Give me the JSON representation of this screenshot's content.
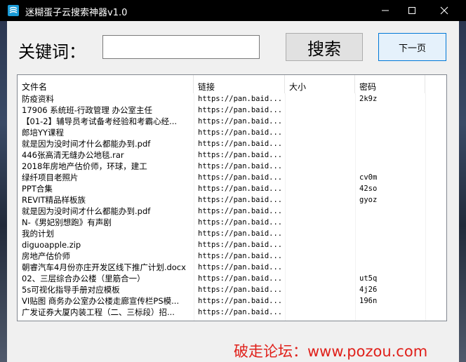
{
  "window": {
    "title": "迷糊蛋子云搜索神器v1.0"
  },
  "search": {
    "label": "关键词：",
    "value": "",
    "button": "搜索",
    "next_button": "下一页"
  },
  "table": {
    "columns": [
      "文件名",
      "链接",
      "大小",
      "密码"
    ],
    "rows": [
      {
        "name": "防疫资料",
        "link": "https://pan.baid...",
        "size": "",
        "pw": "2k9z"
      },
      {
        "name": "17906 系统班-行政管理 办公室主任",
        "link": "https://pan.baid...",
        "size": "",
        "pw": ""
      },
      {
        "name": "【01-2】辅导员考试备考经验和考霸心经...",
        "link": "https://pan.baid...",
        "size": "",
        "pw": ""
      },
      {
        "name": "郎培YY课程",
        "link": "https://pan.baid...",
        "size": "",
        "pw": ""
      },
      {
        "name": "就是因为没时间才什么都能办到.pdf",
        "link": "https://pan.baid...",
        "size": "",
        "pw": ""
      },
      {
        "name": "446张高清无缝办公地毯.rar",
        "link": "https://pan.baid...",
        "size": "",
        "pw": ""
      },
      {
        "name": "2018年房地产估价师，环球，建工",
        "link": "https://pan.baid...",
        "size": "",
        "pw": ""
      },
      {
        "name": "绿纤项目老照片",
        "link": "https://pan.baid...",
        "size": "",
        "pw": "cv0m"
      },
      {
        "name": "PPT合集",
        "link": "https://pan.baid...",
        "size": "",
        "pw": "42so"
      },
      {
        "name": "REVIT精品样板族",
        "link": "https://pan.baid...",
        "size": "",
        "pw": "gyoz"
      },
      {
        "name": "就是因为没时间才什么都能办到.pdf",
        "link": "https://pan.baid...",
        "size": "",
        "pw": ""
      },
      {
        "name": "N-《男妃别想跑》有声剧",
        "link": "https://pan.baid...",
        "size": "",
        "pw": ""
      },
      {
        "name": "我的计划",
        "link": "https://pan.baid...",
        "size": "",
        "pw": ""
      },
      {
        "name": "diguoapple.zip",
        "link": "https://pan.baid...",
        "size": "",
        "pw": ""
      },
      {
        "name": "房地产估价师",
        "link": "https://pan.baid...",
        "size": "",
        "pw": ""
      },
      {
        "name": "朝睿汽车4月份亦庄开发区线下推广计划.docx",
        "link": "https://pan.baid...",
        "size": "",
        "pw": ""
      },
      {
        "name": "02、三层综合办公楼（里筋合一）",
        "link": "https://pan.baid...",
        "size": "",
        "pw": "ut5q"
      },
      {
        "name": "5s可视化指导手册对应模板",
        "link": "https://pan.baid...",
        "size": "",
        "pw": "4j26"
      },
      {
        "name": "VI贴图 商务办公室办公楼走廊宣传栏PS模...",
        "link": "https://pan.baid...",
        "size": "",
        "pw": "196n"
      },
      {
        "name": "广发证券大厦内装工程（二、三标段）招...",
        "link": "https://pan.baid...",
        "size": "",
        "pw": ""
      }
    ]
  },
  "watermark": "破走论坛：www.pozou.com"
}
